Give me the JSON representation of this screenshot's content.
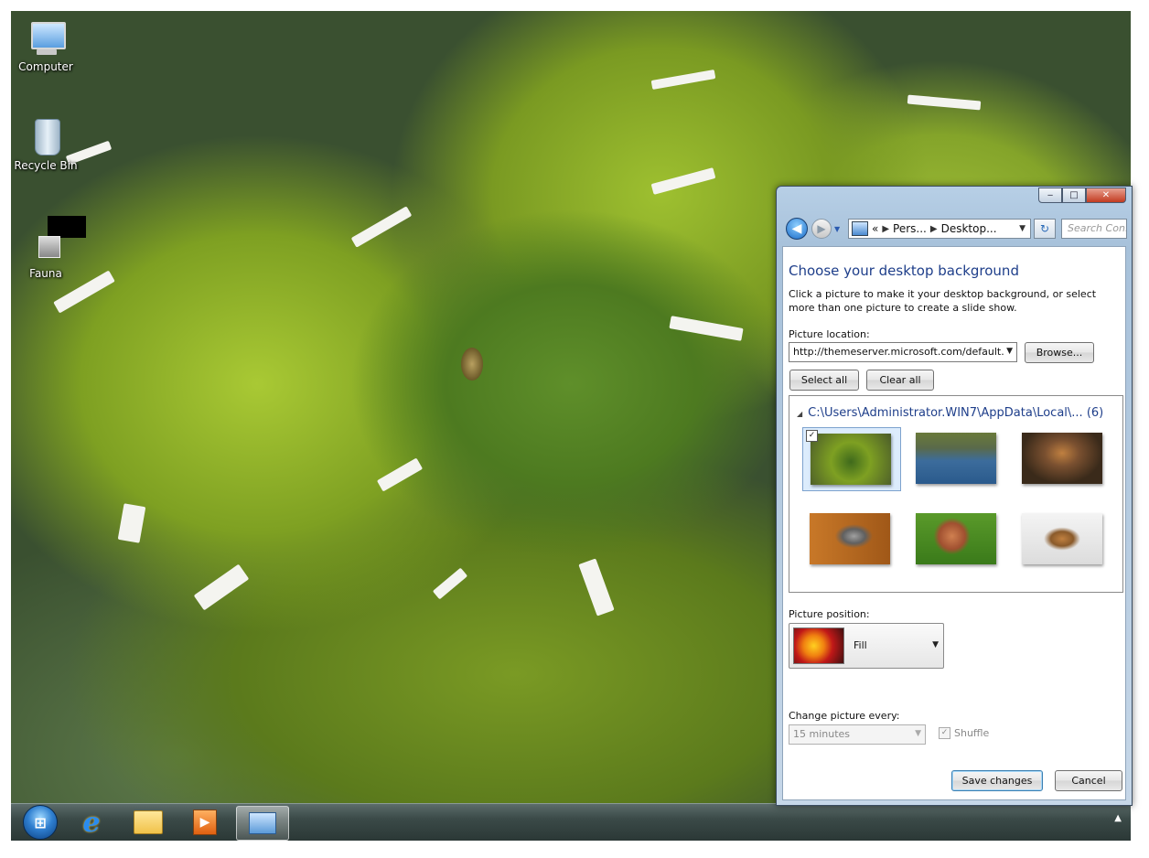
{
  "desktop": {
    "icons": [
      {
        "label": "Computer"
      },
      {
        "label": "Recycle Bin"
      },
      {
        "label": "Fauna"
      }
    ]
  },
  "taskbar": {
    "start_glyph": "⊞",
    "ie_glyph": "e",
    "media_glyph": "▶",
    "tray_glyph": "▲"
  },
  "window": {
    "controls": {
      "minimize": "‒",
      "maximize": "□",
      "close": "✕"
    },
    "nav": {
      "back_glyph": "◀",
      "forward_glyph": "▶",
      "history_glyph": "▼"
    },
    "address": {
      "prefix": "«",
      "crumbs": [
        "Pers...",
        "Desktop..."
      ],
      "sep": "▶",
      "dropdown": "▼"
    },
    "refresh_glyph": "↻",
    "search_placeholder": "Search Con...",
    "title": "Choose your desktop background",
    "description": "Click a picture to make it your desktop background, or select more than one picture to create a slide show.",
    "picture_location_label": "Picture location:",
    "picture_location_value": "http://themeserver.microsoft.com/default.",
    "browse_label": "Browse...",
    "select_all_label": "Select all",
    "clear_all_label": "Clear all",
    "group": {
      "path": "C:\\Users\\Administrator.WIN7\\AppData\\Local\\...",
      "count": "(6)"
    },
    "thumbnails": [
      {
        "name": "green-snake",
        "selected": true,
        "checked": "✓"
      },
      {
        "name": "turtle-water",
        "selected": false
      },
      {
        "name": "chipmunk",
        "selected": false
      },
      {
        "name": "heron",
        "selected": false
      },
      {
        "name": "snail",
        "selected": false
      },
      {
        "name": "giraffe",
        "selected": false
      }
    ],
    "picture_position_label": "Picture position:",
    "picture_position_value": "Fill",
    "change_every_label": "Change picture every:",
    "change_every_value": "15 minutes",
    "shuffle_label": "Shuffle",
    "shuffle_check": "✓",
    "save_label": "Save changes",
    "cancel_label": "Cancel"
  }
}
